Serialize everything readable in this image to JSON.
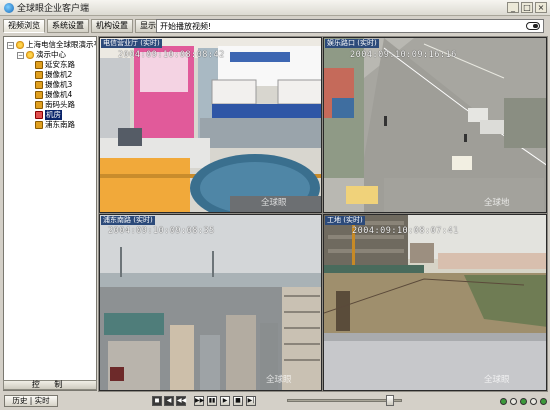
{
  "window": {
    "title": "全球眼企业客户端",
    "controls": [
      "_",
      "□",
      "×"
    ]
  },
  "tabs": [
    {
      "label": "视频浏览",
      "active": true
    },
    {
      "label": "系统设置",
      "active": false
    },
    {
      "label": "机构设置",
      "active": false
    },
    {
      "label": "显示墙",
      "active": false
    }
  ],
  "notice": {
    "text": "开始播放视频!"
  },
  "tree": {
    "root": "上海电信全球眼演示平",
    "group": "演示中心",
    "items": [
      "延安东路",
      "摄像机2",
      "摄像机3",
      "摄像机4",
      "南码头路",
      "机房",
      "浦东南路"
    ],
    "selected_index": 5,
    "control_label": "控 制"
  },
  "panes": [
    {
      "label": "电信营业厅 (实时)",
      "timestamp": "2004:09:10:08:08:42",
      "watermark": "全球眼"
    },
    {
      "label": "娱乐路口 (实时)",
      "timestamp": "2004:09:10:09:16:16",
      "watermark": "全球地"
    },
    {
      "label": "浦东南路 (实时)",
      "timestamp": "2004:09:10:09:08:35",
      "watermark": "全球眼"
    },
    {
      "label": "工地 (实时)",
      "timestamp": "2004:09:10:08:07:41",
      "watermark": "全球眼"
    }
  ],
  "statusbar": {
    "mode_button": "历史 | 实时"
  },
  "colors": {
    "selection": "#0a246a",
    "pane_label_bg": "#2c4a7a"
  }
}
